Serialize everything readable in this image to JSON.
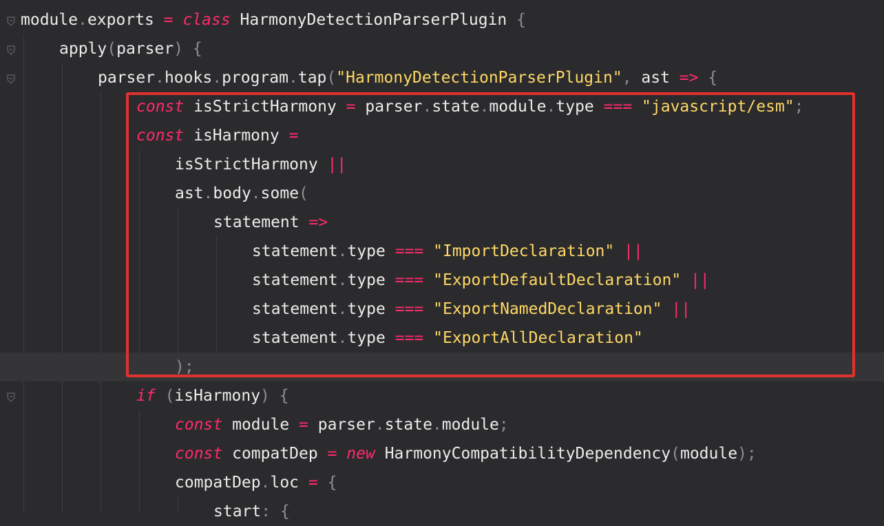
{
  "editor": {
    "theme_colors": {
      "background": "#2b2b2d",
      "keyword": "#ff2a6d",
      "string": "#ffd866",
      "punctuation": "#8e8e94",
      "identifier": "#ececec",
      "highlight_box": "#e0322e"
    },
    "lines": [
      {
        "tokens": [
          [
            "id",
            "module"
          ],
          [
            "pun",
            "."
          ],
          [
            "id",
            "exports "
          ],
          [
            "op",
            "="
          ],
          [
            "id",
            " "
          ],
          [
            "kw",
            "class"
          ],
          [
            "id",
            " HarmonyDetectionParserPlugin "
          ],
          [
            "pun",
            "{"
          ]
        ]
      },
      {
        "tokens": [
          [
            "id",
            "apply"
          ],
          [
            "pun",
            "("
          ],
          [
            "id",
            "parser"
          ],
          [
            "pun",
            ")"
          ],
          [
            "id",
            " "
          ],
          [
            "pun",
            "{"
          ]
        ]
      },
      {
        "tokens": [
          [
            "id",
            "parser"
          ],
          [
            "pun",
            "."
          ],
          [
            "id",
            "hooks"
          ],
          [
            "pun",
            "."
          ],
          [
            "id",
            "program"
          ],
          [
            "pun",
            "."
          ],
          [
            "id",
            "tap"
          ],
          [
            "pun",
            "("
          ],
          [
            "str",
            "\"HarmonyDetectionParserPlugin\""
          ],
          [
            "pun",
            ","
          ],
          [
            "id",
            " ast "
          ],
          [
            "op",
            "=>"
          ],
          [
            "id",
            " "
          ],
          [
            "pun",
            "{"
          ]
        ]
      },
      {
        "tokens": [
          [
            "kw",
            "const"
          ],
          [
            "id",
            " isStrictHarmony "
          ],
          [
            "op",
            "="
          ],
          [
            "id",
            " parser"
          ],
          [
            "pun",
            "."
          ],
          [
            "id",
            "state"
          ],
          [
            "pun",
            "."
          ],
          [
            "id",
            "module"
          ],
          [
            "pun",
            "."
          ],
          [
            "id",
            "type "
          ],
          [
            "op",
            "==="
          ],
          [
            "id",
            " "
          ],
          [
            "str",
            "\"javascript/esm\""
          ],
          [
            "pun",
            ";"
          ]
        ]
      },
      {
        "tokens": [
          [
            "kw",
            "const"
          ],
          [
            "id",
            " isHarmony "
          ],
          [
            "op",
            "="
          ]
        ]
      },
      {
        "tokens": [
          [
            "id",
            "isStrictHarmony "
          ],
          [
            "op",
            "||"
          ]
        ]
      },
      {
        "tokens": [
          [
            "id",
            "ast"
          ],
          [
            "pun",
            "."
          ],
          [
            "id",
            "body"
          ],
          [
            "pun",
            "."
          ],
          [
            "id",
            "some"
          ],
          [
            "pun",
            "("
          ]
        ]
      },
      {
        "tokens": [
          [
            "id",
            "statement "
          ],
          [
            "op",
            "=>"
          ]
        ]
      },
      {
        "tokens": [
          [
            "id",
            "statement"
          ],
          [
            "pun",
            "."
          ],
          [
            "id",
            "type "
          ],
          [
            "op",
            "==="
          ],
          [
            "id",
            " "
          ],
          [
            "str",
            "\"ImportDeclaration\""
          ],
          [
            "id",
            " "
          ],
          [
            "op",
            "||"
          ]
        ]
      },
      {
        "tokens": [
          [
            "id",
            "statement"
          ],
          [
            "pun",
            "."
          ],
          [
            "id",
            "type "
          ],
          [
            "op",
            "==="
          ],
          [
            "id",
            " "
          ],
          [
            "str",
            "\"ExportDefaultDeclaration\""
          ],
          [
            "id",
            " "
          ],
          [
            "op",
            "||"
          ]
        ]
      },
      {
        "tokens": [
          [
            "id",
            "statement"
          ],
          [
            "pun",
            "."
          ],
          [
            "id",
            "type "
          ],
          [
            "op",
            "==="
          ],
          [
            "id",
            " "
          ],
          [
            "str",
            "\"ExportNamedDeclaration\""
          ],
          [
            "id",
            " "
          ],
          [
            "op",
            "||"
          ]
        ]
      },
      {
        "tokens": [
          [
            "id",
            "statement"
          ],
          [
            "pun",
            "."
          ],
          [
            "id",
            "type "
          ],
          [
            "op",
            "==="
          ],
          [
            "id",
            " "
          ],
          [
            "str",
            "\"ExportAllDeclaration\""
          ]
        ]
      },
      {
        "tokens": [
          [
            "pun",
            ");"
          ]
        ]
      },
      {
        "tokens": [
          [
            "kw",
            "if"
          ],
          [
            "id",
            " "
          ],
          [
            "pun",
            "("
          ],
          [
            "id",
            "isHarmony"
          ],
          [
            "pun",
            ")"
          ],
          [
            "id",
            " "
          ],
          [
            "pun",
            "{"
          ]
        ]
      },
      {
        "tokens": [
          [
            "kw",
            "const"
          ],
          [
            "id",
            " module "
          ],
          [
            "op",
            "="
          ],
          [
            "id",
            " parser"
          ],
          [
            "pun",
            "."
          ],
          [
            "id",
            "state"
          ],
          [
            "pun",
            "."
          ],
          [
            "id",
            "module"
          ],
          [
            "pun",
            ";"
          ]
        ]
      },
      {
        "tokens": [
          [
            "kw",
            "const"
          ],
          [
            "id",
            " compatDep "
          ],
          [
            "op",
            "="
          ],
          [
            "id",
            " "
          ],
          [
            "kw",
            "new"
          ],
          [
            "id",
            " HarmonyCompatibilityDependency"
          ],
          [
            "pun",
            "("
          ],
          [
            "id",
            "module"
          ],
          [
            "pun",
            ");"
          ]
        ]
      },
      {
        "tokens": [
          [
            "id",
            "compatDep"
          ],
          [
            "pun",
            "."
          ],
          [
            "id",
            "loc "
          ],
          [
            "op",
            "="
          ],
          [
            "id",
            " "
          ],
          [
            "pun",
            "{"
          ]
        ]
      },
      {
        "tokens": [
          [
            "id",
            "start"
          ],
          [
            "pun",
            ":"
          ],
          [
            "id",
            " "
          ],
          [
            "pun",
            "{"
          ]
        ]
      }
    ]
  }
}
